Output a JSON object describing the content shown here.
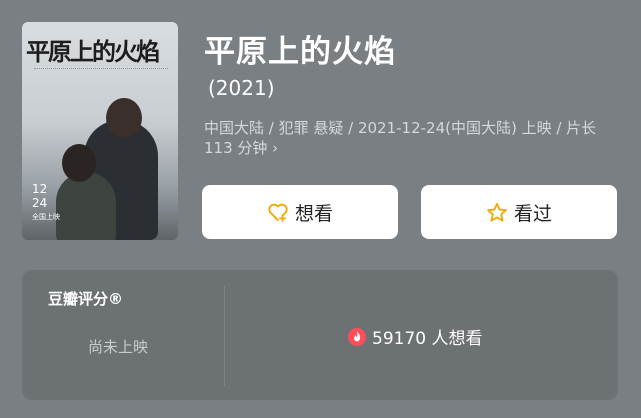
{
  "movie": {
    "title": "平原上的火焰",
    "year": "(2021)",
    "meta": "中国大陆 / 犯罪 悬疑 / 2021-12-24(中国大陆) 上映 / 片长 113 分钟 ›",
    "poster": {
      "title": "平原上的火焰",
      "date": "12",
      "date2": "24",
      "date_note": "全国上映"
    }
  },
  "actions": {
    "want_label": "想看",
    "seen_label": "看过",
    "want_icon": "heart-plus-icon",
    "seen_icon": "star-icon",
    "icon_color": "#f2a900"
  },
  "rating": {
    "title": "豆瓣评分®",
    "status": "尚未上映",
    "want_count": "59170 人想看",
    "want_icon": "flame-icon",
    "flame_color": "#ff4d5a"
  }
}
